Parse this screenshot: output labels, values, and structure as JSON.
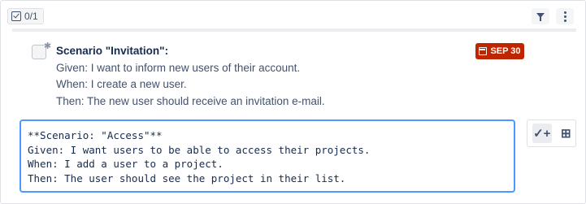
{
  "header": {
    "counter_label": "0/1",
    "filter_icon": "filter-icon",
    "more_icon": "more-vertical-icon"
  },
  "item": {
    "title": "Scenario \"Invitation\":",
    "lines": [
      "Given: I want to inform new users of their account.",
      "When: I create a new user.",
      "Then: The new user should receive an invitation e-mail."
    ],
    "due_date": "SEP 30",
    "due_color": "#bf2600"
  },
  "editor": {
    "text": "**Scenario: \"Access\"**\nGiven: I want users to be able to access their projects.\nWhen: I add a user to a project.\nThen: The user should see the project in their list."
  },
  "actions": {
    "add_check_icon": "check-plus-icon",
    "add_to_list_icon": "add-to-list-icon"
  },
  "colors": {
    "accent": "#4c9aff",
    "due_badge": "#bf2600"
  }
}
